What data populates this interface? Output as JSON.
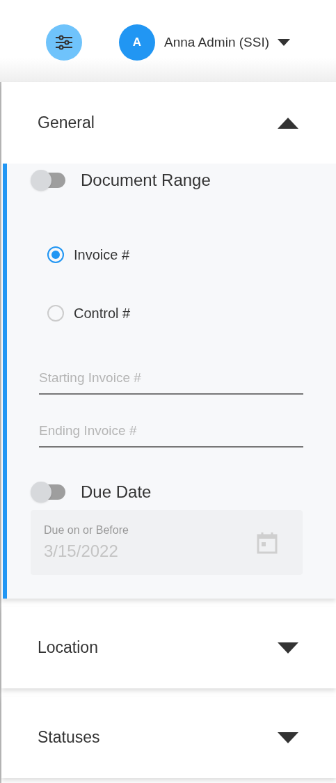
{
  "header": {
    "avatar_initial": "A",
    "user_name": "Anna Admin (SSI)"
  },
  "sections": [
    {
      "title": "General",
      "expanded": true,
      "content": {
        "document_range": {
          "label": "Document Range",
          "on": false
        },
        "radios": [
          {
            "label": "Invoice #",
            "selected": true
          },
          {
            "label": "Control #",
            "selected": false
          }
        ],
        "fields": [
          {
            "placeholder": "Starting Invoice #"
          },
          {
            "placeholder": "Ending Invoice #"
          }
        ],
        "due_date": {
          "label": "Due Date",
          "on": false
        },
        "date_field": {
          "label": "Due on or Before",
          "value": "3/15/2022",
          "disabled": true
        }
      }
    },
    {
      "title": "Location",
      "expanded": false
    },
    {
      "title": "Statuses",
      "expanded": false
    }
  ]
}
